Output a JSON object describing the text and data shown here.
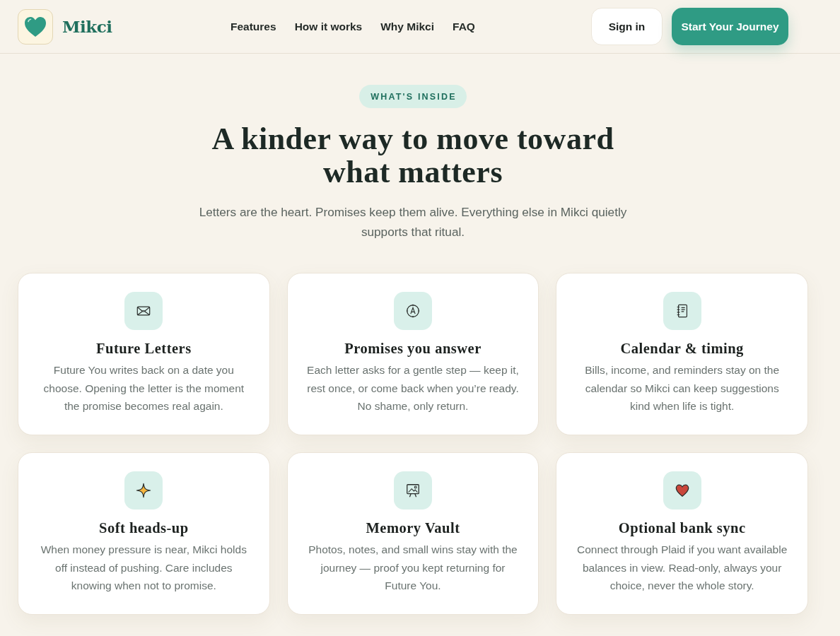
{
  "header": {
    "brand": "Mikci",
    "nav": [
      "Features",
      "How it works",
      "Why Mikci",
      "FAQ"
    ],
    "sign_in": "Sign in",
    "cta": "Start Your Journey"
  },
  "section": {
    "badge": "WHAT'S INSIDE",
    "title": "A kinder way to move toward what matters",
    "subtitle": "Letters are the heart. Promises keep them alive. Everything else in Mikci quietly supports that ritual."
  },
  "features": [
    {
      "kind": "envelope",
      "title": "Future Letters",
      "text": "Future You writes back on a date you choose. Opening the letter is the moment the promise becomes real again."
    },
    {
      "kind": "compass",
      "title": "Promises you answer",
      "text": "Each letter asks for a gentle step — keep it, rest once, or come back when you’re ready. No shame, only return."
    },
    {
      "kind": "notebook",
      "title": "Calendar & timing",
      "text": "Bills, income, and reminders stay on the calendar so Mikci can keep suggestions kind when life is tight."
    },
    {
      "kind": "sparkle",
      "title": "Soft heads-up",
      "text": "When money pressure is near, Mikci holds off instead of pushing. Care includes knowing when not to promise."
    },
    {
      "kind": "easel",
      "title": "Memory Vault",
      "text": "Photos, notes, and small wins stay with the journey — proof you kept returning for Future You."
    },
    {
      "kind": "heart",
      "title": "Optional bank sync",
      "text": "Connect through Plaid if you want available balances in view. Read-only, always your choice, never the whole story."
    }
  ]
}
